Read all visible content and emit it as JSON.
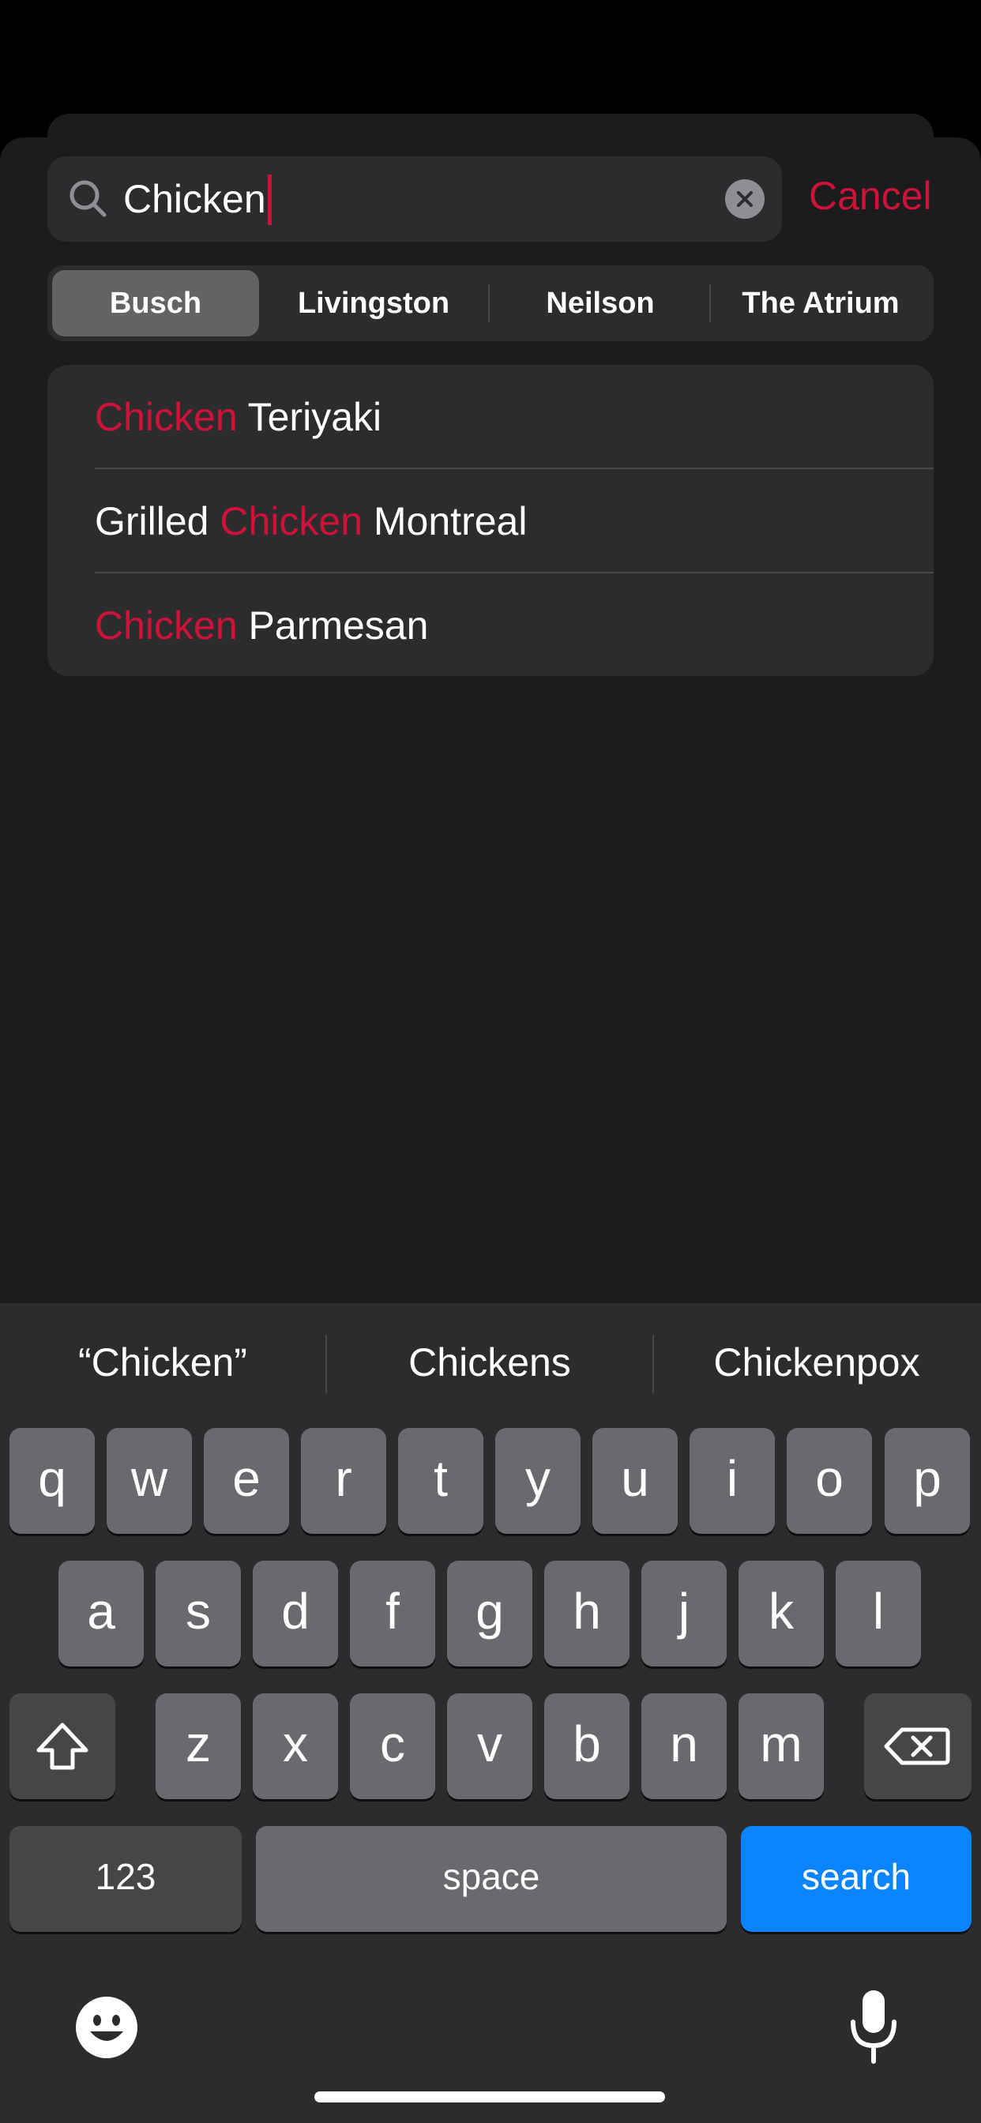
{
  "search": {
    "query": "Chicken",
    "cancel_label": "Cancel"
  },
  "segments": [
    "Busch",
    "Livingston",
    "Neilson",
    "The Atrium"
  ],
  "selected_segment": "Busch",
  "results": [
    {
      "before": "",
      "match": "Chicken",
      "after": " Teriyaki"
    },
    {
      "before": "Grilled ",
      "match": "Chicken",
      "after": " Montreal"
    },
    {
      "before": "",
      "match": "Chicken",
      "after": " Parmesan"
    }
  ],
  "keyboard": {
    "suggestions": [
      "“Chicken”",
      "Chickens",
      "Chickenpox"
    ],
    "row1": [
      "q",
      "w",
      "e",
      "r",
      "t",
      "y",
      "u",
      "i",
      "o",
      "p"
    ],
    "row2": [
      "a",
      "s",
      "d",
      "f",
      "g",
      "h",
      "j",
      "k",
      "l"
    ],
    "row3": [
      "z",
      "x",
      "c",
      "v",
      "b",
      "n",
      "m"
    ],
    "numbers_label": "123",
    "space_label": "space",
    "search_label": "search",
    "icons": [
      "shift-icon",
      "backspace-icon",
      "emoji-icon",
      "microphone-icon"
    ]
  },
  "colors": {
    "accent": "#cf1237",
    "search_key": "#0a84ff",
    "background": "#1c1c1e",
    "card": "#2c2c2e"
  }
}
